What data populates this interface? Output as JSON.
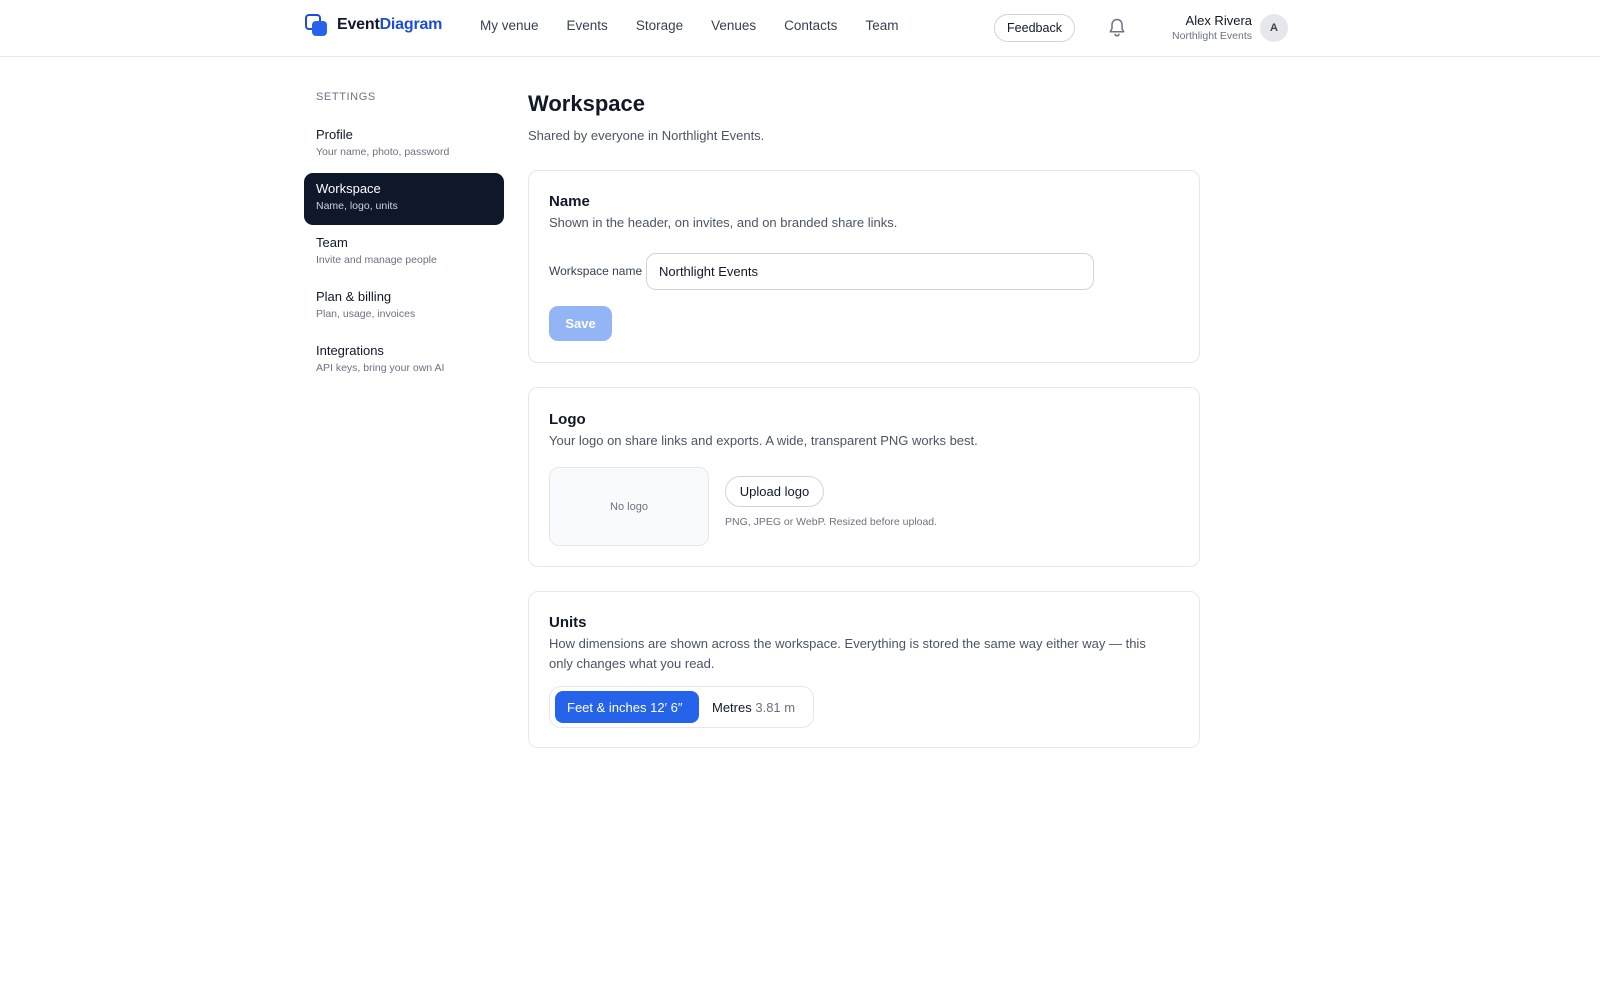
{
  "header": {
    "brand_part1": "Event",
    "brand_part2": "Diagram",
    "nav": [
      "My venue",
      "Events",
      "Storage",
      "Venues",
      "Contacts",
      "Team"
    ],
    "feedback_label": "Feedback",
    "user_name": "Alex Rivera",
    "user_org": "Northlight Events",
    "avatar_initial": "A"
  },
  "sidebar": {
    "title": "SETTINGS",
    "items": [
      {
        "label": "Profile",
        "sub": "Your name, photo, password"
      },
      {
        "label": "Workspace",
        "sub": "Name, logo, units"
      },
      {
        "label": "Team",
        "sub": "Invite and manage people"
      },
      {
        "label": "Plan & billing",
        "sub": "Plan, usage, invoices"
      },
      {
        "label": "Integrations",
        "sub": "API keys, bring your own AI"
      }
    ],
    "active_index": 1
  },
  "main": {
    "title": "Workspace",
    "subtitle": "Shared by everyone in Northlight Events."
  },
  "name_card": {
    "title": "Name",
    "desc": "Shown in the header, on invites, and on branded share links.",
    "field_label": "Workspace name",
    "field_value": "Northlight Events",
    "save_label": "Save"
  },
  "logo_card": {
    "title": "Logo",
    "desc": "Your logo on share links and exports. A wide, transparent PNG works best.",
    "placeholder": "No logo",
    "upload_label": "Upload logo",
    "hint": "PNG, JPEG or WebP. Resized before upload."
  },
  "units_card": {
    "title": "Units",
    "desc": "How dimensions are shown across the workspace. Everything is stored the same way either way — this only changes what you read.",
    "options": [
      {
        "label": "Feet & inches",
        "example": "12′ 6″",
        "selected": true
      },
      {
        "label": "Metres",
        "example": "3.81 m",
        "selected": false
      }
    ]
  },
  "colors": {
    "accent": "#2563eb",
    "sidebar_active": "#0f172a",
    "save_disabled": "#93b4f5"
  },
  "icons": {
    "bell": "bell-icon",
    "logo": "event-diagram-logo-icon"
  }
}
